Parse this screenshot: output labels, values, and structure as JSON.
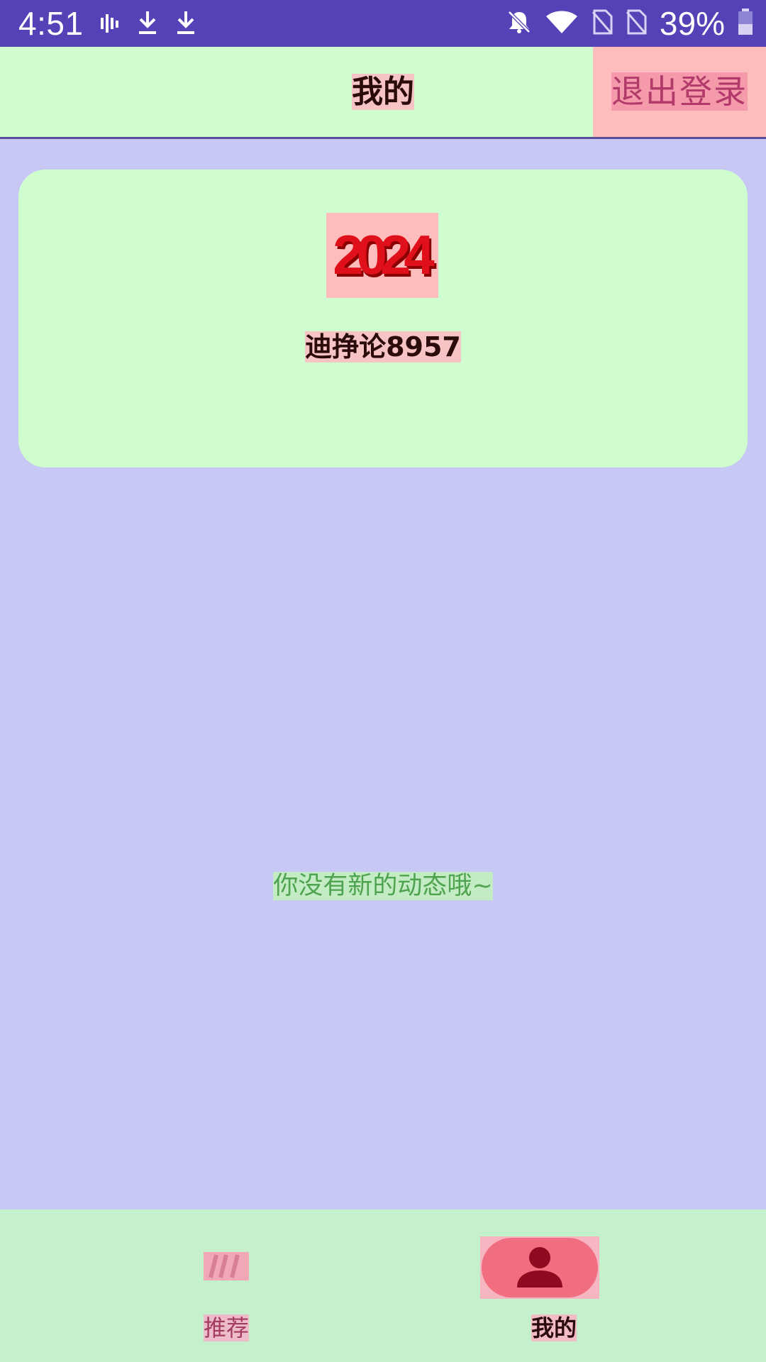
{
  "status_bar": {
    "time": "4:51",
    "battery_text": "39%",
    "left_icons": [
      "signal-bars-icon",
      "download-icon",
      "download-icon"
    ],
    "right_icons": [
      "bell-off-icon",
      "wifi-icon",
      "sim-off-icon",
      "sim-off-icon",
      "battery-icon"
    ],
    "background": "#5343b6"
  },
  "header": {
    "title": "我的",
    "logout_label": "退出登录"
  },
  "profile": {
    "avatar_text": "2024",
    "username": "迪挣论8957"
  },
  "feed": {
    "empty_message": "你没有新的动态哦~"
  },
  "bottom_nav": {
    "items": [
      {
        "label": "推荐",
        "icon": "recommend-icon",
        "selected": false
      },
      {
        "label": "我的",
        "icon": "person-icon",
        "selected": true
      }
    ]
  },
  "colors": {
    "page_background": "#c8c8f5",
    "surface_green": "#d0fdd0",
    "accent_pink": "#fdbdbd",
    "selected_pill": "#f06e7f",
    "empty_text": "#4fa350"
  }
}
